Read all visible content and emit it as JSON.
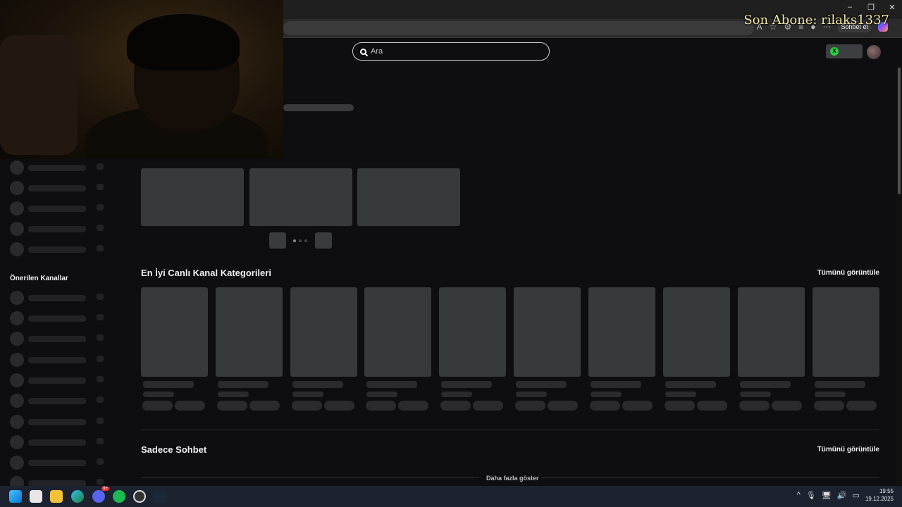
{
  "overlay": {
    "subscriber_text": "Son Abone: rilaks1337"
  },
  "browser": {
    "chat_label": "Sohbet et"
  },
  "header": {
    "search_placeholder": "Ara"
  },
  "sidebar": {
    "recommended_title": "Önerilen Kanallar"
  },
  "sections": {
    "top_categories_title": "En İyi Canlı Kanal Kategorileri",
    "top_categories_see_all": "Tümünü görüntüle",
    "just_chatting_title": "Sadece Sohbet",
    "just_chatting_see_all": "Tümünü görüntüle",
    "show_more": "Daha fazla göster"
  },
  "taskbar": {
    "time": "19:55",
    "date": "19.12.2025",
    "icons": [
      "windows-start-icon",
      "store-icon",
      "file-explorer-icon",
      "edge-icon",
      "discord-icon",
      "spotify-icon",
      "obs-icon",
      "steam-icon"
    ],
    "discord_badge": "9+"
  },
  "colors": {
    "background": "#0e0e10",
    "skeleton": "#38393b",
    "taskbar": "#1c2230",
    "overlay_text": "#f0e6a8"
  }
}
